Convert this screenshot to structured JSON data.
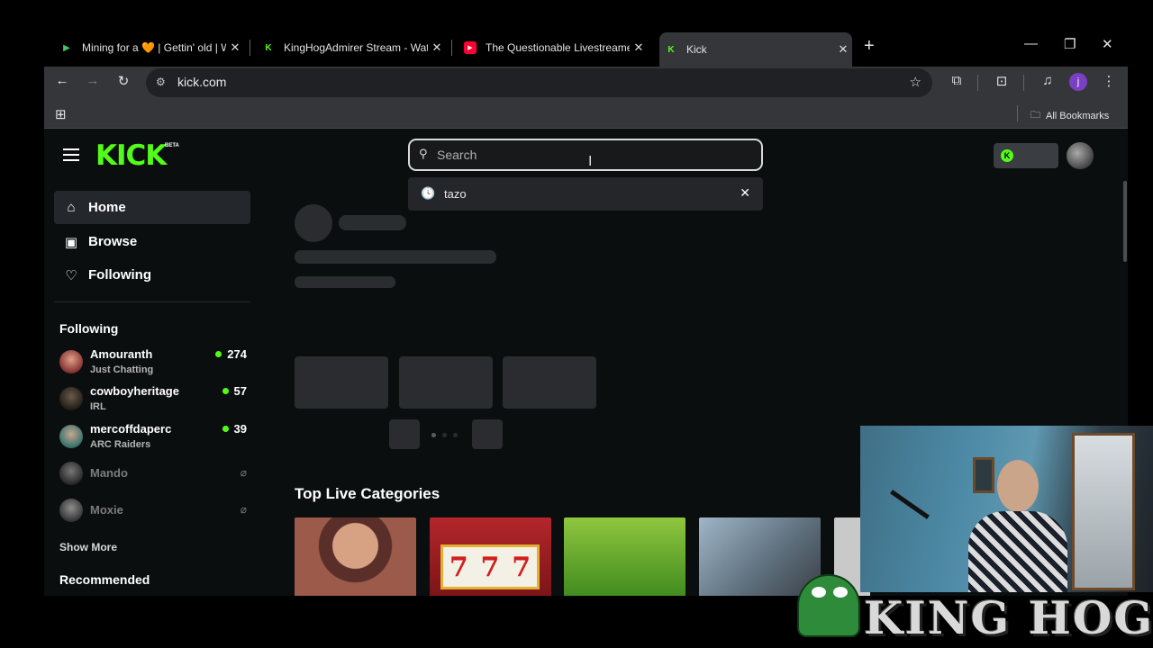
{
  "browser": {
    "tabs": [
      {
        "title": "Mining for a 🧡 | Gettin' old | W",
        "favicon": "rumble-icon",
        "color": "#4ac55e"
      },
      {
        "title": "KingHogAdmirer Stream - Watc",
        "favicon": "kick-icon",
        "color": "#53fc18"
      },
      {
        "title": "The Questionable Livestreamer",
        "favicon": "youtube-icon",
        "color": "#ff0033"
      },
      {
        "title": "Kick",
        "favicon": "kick-icon",
        "color": "#53fc18"
      }
    ],
    "url": "kick.com",
    "profile_initial": "j",
    "bookmarks_label": "All Bookmarks"
  },
  "kick": {
    "logo": "KICK",
    "logo_badge": "BETA",
    "search": {
      "placeholder": "Search",
      "value": ""
    },
    "recent_search": "tazo",
    "nav": [
      {
        "label": "Home",
        "icon": "home-icon",
        "active": true
      },
      {
        "label": "Browse",
        "icon": "browse-icon",
        "active": false
      },
      {
        "label": "Following",
        "icon": "heart-icon",
        "active": false
      }
    ],
    "following_heading": "Following",
    "following": [
      {
        "name": "Amouranth",
        "category": "Just Chatting",
        "viewers": "274",
        "live": true
      },
      {
        "name": "cowboyheritage",
        "category": "IRL",
        "viewers": "57",
        "live": true
      },
      {
        "name": "mercoffdaperc",
        "category": "ARC Raiders",
        "viewers": "39",
        "live": true
      },
      {
        "name": "Mando",
        "live": false
      },
      {
        "name": "Moxie",
        "live": false
      }
    ],
    "show_more": "Show More",
    "recommended_heading": "Recommended",
    "top_categories_heading": "Top Live Categories"
  },
  "overlay": {
    "brand_text": "KING HOG"
  },
  "colors": {
    "accent": "#53fc18",
    "page_bg": "#0b0e0f",
    "skeleton": "#2a2c30"
  }
}
